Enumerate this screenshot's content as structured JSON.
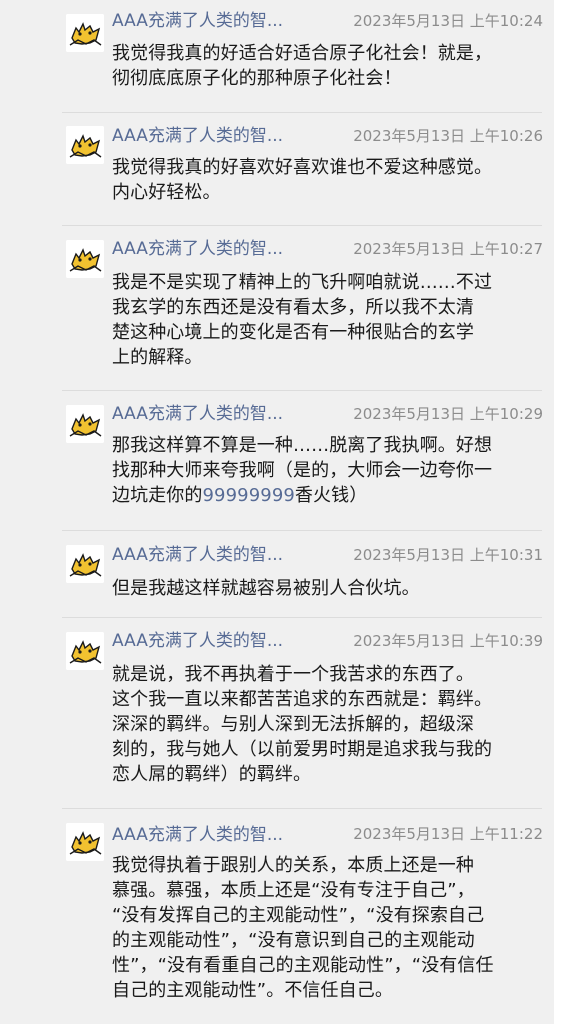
{
  "sender": "AAA充满了人类的智...",
  "messages": [
    {
      "time": "2023年5月13日 上午10:24",
      "lines": [
        "我觉得我真的好适合好适合原子化社会！就是，",
        "彻彻底底原子化的那种原子化社会！"
      ]
    },
    {
      "time": "2023年5月13日 上午10:26",
      "lines": [
        "我觉得我真的好喜欢好喜欢谁也不爱这种感觉。",
        "内心好轻松。"
      ]
    },
    {
      "time": "2023年5月13日 上午10:27",
      "lines": [
        "我是不是实现了精神上的飞升啊咱就说……不过",
        "我玄学的东西还是没有看太多，所以我不太清",
        "楚这种心境上的变化是否有一种很贴合的玄学",
        "上的解释。"
      ]
    },
    {
      "time": "2023年5月13日 上午10:29",
      "lines": [
        "那我这样算不算是一种……脱离了我执啊。好想",
        "找那种大师来夸我啊（是的，大师会一边夸你一"
      ],
      "line3_before": "边坑走你的",
      "line3_number": "99999999",
      "line3_after": "香火钱）"
    },
    {
      "time": "2023年5月13日 上午10:31",
      "lines": [
        "但是我越这样就越容易被别人合伙坑。"
      ]
    },
    {
      "time": "2023年5月13日 上午10:39",
      "lines": [
        "就是说，我不再执着于一个我苦求的东西了。",
        "这个我一直以来都苦苦追求的东西就是：羁绊。",
        "深深的羁绊。与别人深到无法拆解的，超级深",
        "刻的，我与她人（以前爱男时期是追求我与我的",
        "恋人屌的羁绊）的羁绊。"
      ]
    },
    {
      "time": "2023年5月13日 上午11:22",
      "lines": [
        "我觉得执着于跟别人的关系，本质上还是一种",
        "慕强。慕强，本质上还是“没有专注于自己”，",
        "“没有发挥自己的主观能动性”，“没有探索自己",
        "的主观能动性”，“没有意识到自己的主观能动",
        "性”，“没有看重自己的主观能动性”，“没有信任",
        "自己的主观能动性”。不信任自己。"
      ]
    }
  ]
}
